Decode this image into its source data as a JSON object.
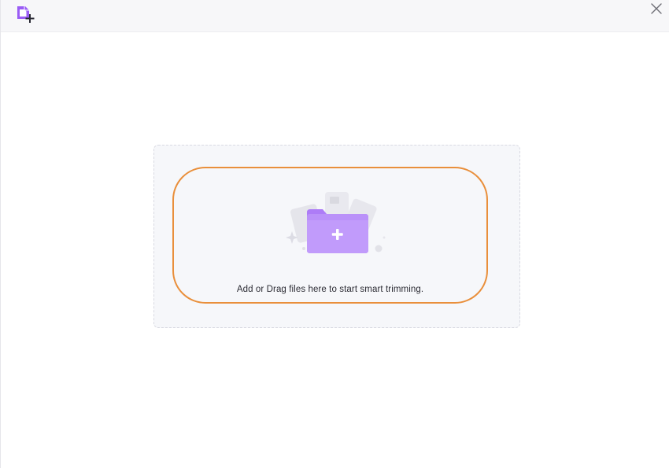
{
  "window": {
    "icons": {
      "app": "add-file-icon",
      "close": "close-icon"
    }
  },
  "drop_zone": {
    "hint_text": "Add or Drag files here to start smart trimming.",
    "illustration": "folder-add-icon",
    "accent_color": "#a56dfb",
    "border_color": "#e98f3b"
  }
}
